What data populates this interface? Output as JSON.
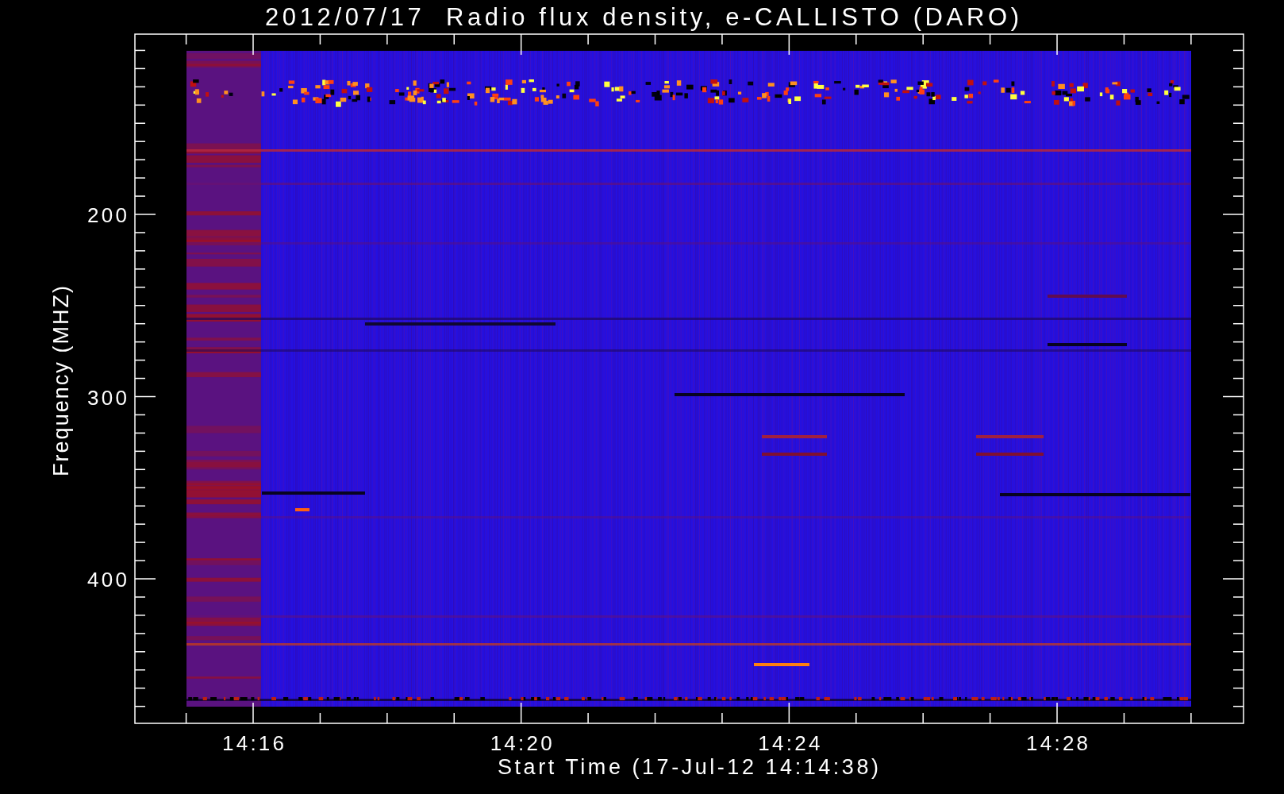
{
  "plot": {
    "title": "2012/07/17  Radio flux density, e-CALLISTO (DARO)",
    "ylabel": "Frequency (MHZ)",
    "xlabel": "Start Time (17-Jul-12 14:14:38)",
    "yticks": [
      "200",
      "300",
      "400"
    ],
    "xticks": [
      "14:16",
      "14:20",
      "14:24",
      "14:28"
    ]
  }
}
